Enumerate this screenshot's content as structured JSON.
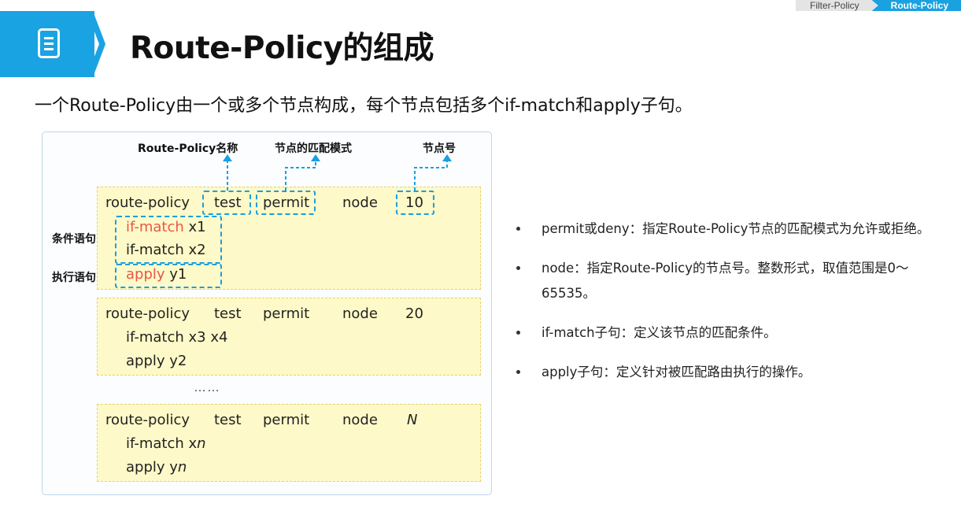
{
  "breadcrumb": {
    "items": [
      "Filter-Policy",
      "Route-Policy"
    ]
  },
  "header": {
    "title": "Route-Policy的组成",
    "icon": "document-icon"
  },
  "intro": "一个Route-Policy由一个或多个节点构成，每个节点包括多个if-match和apply子句。",
  "diagram": {
    "labels": {
      "name": "Route-Policy名称",
      "mode": "节点的匹配模式",
      "node_number": "节点号",
      "condition": "条件语句",
      "action": "执行语句"
    },
    "nodes": [
      {
        "kw": "route-policy",
        "name": "test",
        "mode": "permit",
        "nodekw": "node",
        "num": "10",
        "match1_kw": "if-match",
        "match1_val": " x1",
        "match2": "if-match x2",
        "apply_kw": "apply",
        "apply_val": " y1"
      },
      {
        "kw": "route-policy",
        "name": "test",
        "mode": "permit",
        "nodekw": "node",
        "num": "20",
        "match": "if-match x3 x4",
        "apply": "apply y2"
      },
      {
        "kw": "route-policy",
        "name": "test",
        "mode": "permit",
        "nodekw": "node",
        "num": "N",
        "match_prefix": "if-match x",
        "match_var": "n",
        "apply_prefix": "apply y",
        "apply_var": "n"
      }
    ],
    "ellipsis": "……"
  },
  "bullets": [
    "permit或deny：指定Route-Policy节点的匹配模式为允许或拒绝。",
    "node：指定Route-Policy的节点号。整数形式，取值范围是0～65535。",
    "if-match子句：定义该节点的匹配条件。",
    "apply子句：定义针对被匹配路由执行的操作。"
  ],
  "colors": {
    "accent": "#1aa3e2",
    "highlight": "#e8574b",
    "node_bg": "#fef9c8"
  }
}
